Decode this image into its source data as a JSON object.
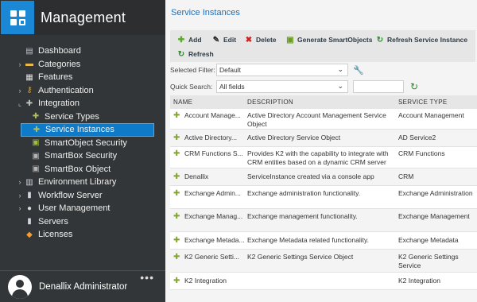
{
  "app": {
    "title": "Management"
  },
  "sidebar": {
    "items": [
      {
        "label": "Dashboard",
        "icon": "dashboard-icon"
      },
      {
        "label": "Categories",
        "icon": "folder-icon"
      },
      {
        "label": "Features",
        "icon": "features-icon"
      },
      {
        "label": "Authentication",
        "icon": "key-icon"
      },
      {
        "label": "Integration",
        "icon": "puzzle-icon"
      },
      {
        "label": "Service Types",
        "icon": "puzzle-gear-icon"
      },
      {
        "label": "Service Instances",
        "icon": "service-instance-icon"
      },
      {
        "label": "SmartObject Security",
        "icon": "smartobject-icon"
      },
      {
        "label": "SmartBox Security",
        "icon": "smartbox-icon"
      },
      {
        "label": "SmartBox Object",
        "icon": "smartbox-icon"
      },
      {
        "label": "Environment Library",
        "icon": "book-icon"
      },
      {
        "label": "Workflow Server",
        "icon": "server-icon"
      },
      {
        "label": "User Management",
        "icon": "user-icon"
      },
      {
        "label": "Servers",
        "icon": "server-icon"
      },
      {
        "label": "Licenses",
        "icon": "license-icon"
      }
    ],
    "user": {
      "name": "Denallix Administrator",
      "more": "•••"
    }
  },
  "main": {
    "title": "Service Instances",
    "toolbar": {
      "add": "Add",
      "edit": "Edit",
      "delete": "Delete",
      "generate": "Generate SmartObjects",
      "refresh_instance": "Refresh Service Instance",
      "refresh": "Refresh"
    },
    "filter": {
      "label": "Selected Filter:",
      "value": "Default"
    },
    "search": {
      "label": "Quick Search:",
      "scope": "All fields",
      "value": ""
    },
    "table": {
      "columns": [
        "NAME",
        "DESCRIPTION",
        "SERVICE TYPE"
      ],
      "rows": [
        {
          "name": "Account Manage...",
          "description": "Active Directory Account Management Service Object",
          "type": "Account Management"
        },
        {
          "name": "Active Directory...",
          "description": "Active Directory Service Object",
          "type": "AD Service2"
        },
        {
          "name": "CRM Functions S...",
          "description": "Provides K2 with the capability to integrate with CRM entities based on a dynamic CRM server",
          "type": "CRM Functions"
        },
        {
          "name": "Denallix",
          "description": "ServiceInstance created via a console app",
          "type": "CRM"
        },
        {
          "name": "Exchange Admin...",
          "description": "Exchange administration functionality.",
          "type": "Exchange Administration"
        },
        {
          "name": "Exchange Manag...",
          "description": "Exchange management functionality.",
          "type": "Exchange Management"
        },
        {
          "name": "Exchange Metada...",
          "description": "Exchange Metadata related functionality.",
          "type": "Exchange Metadata"
        },
        {
          "name": "K2 Generic Setti...",
          "description": "K2 Generic Settings Service Object",
          "type": "K2 Generic Settings Service"
        },
        {
          "name": "K2 Integration",
          "description": "",
          "type": "K2 Integration"
        }
      ]
    }
  }
}
